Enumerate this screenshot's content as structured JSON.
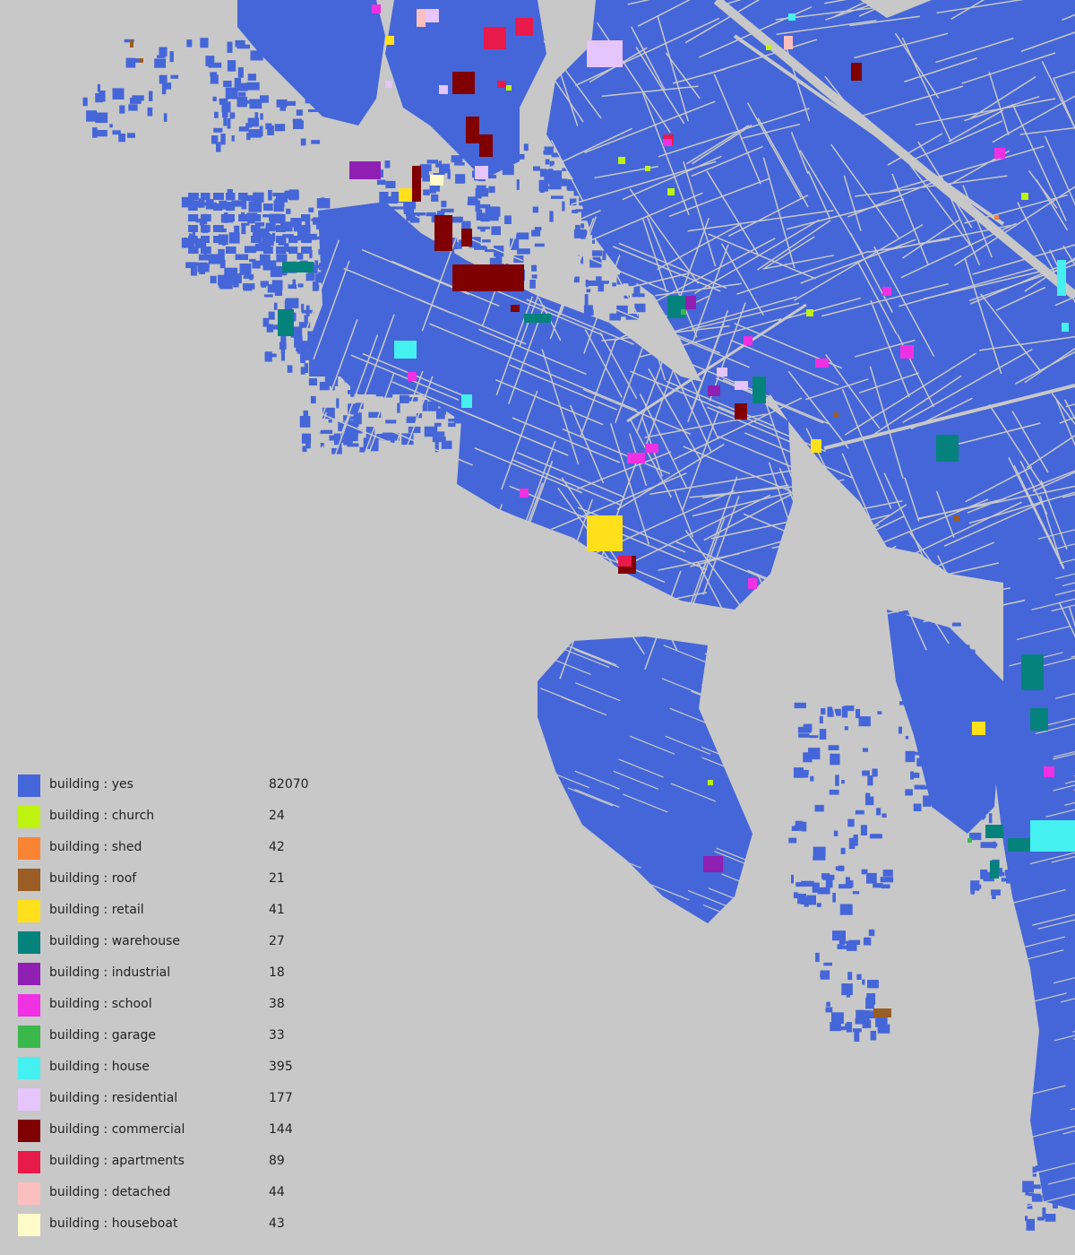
{
  "map": {
    "background_color": "#c8c8c8",
    "default_building_color": "#4566d8"
  },
  "legend": [
    {
      "key": "building",
      "value": "yes",
      "label": "building : yes",
      "count": "82070",
      "color": "#4566d8"
    },
    {
      "key": "building",
      "value": "church",
      "label": "building : church",
      "count": "24",
      "color": "#bef20f"
    },
    {
      "key": "building",
      "value": "shed",
      "label": "building : shed",
      "count": "42",
      "color": "#f98434"
    },
    {
      "key": "building",
      "value": "roof",
      "label": "building : roof",
      "count": "21",
      "color": "#9a5e24"
    },
    {
      "key": "building",
      "value": "retail",
      "label": "building : retail",
      "count": "41",
      "color": "#ffe01b"
    },
    {
      "key": "building",
      "value": "warehouse",
      "label": "building : warehouse",
      "count": "27",
      "color": "#06827c"
    },
    {
      "key": "building",
      "value": "industrial",
      "label": "building : industrial",
      "count": "18",
      "color": "#901fb3"
    },
    {
      "key": "building",
      "value": "school",
      "label": "building : school",
      "count": "38",
      "color": "#f030e3"
    },
    {
      "key": "building",
      "value": "garage",
      "label": "building : garage",
      "count": "33",
      "color": "#3bb84b"
    },
    {
      "key": "building",
      "value": "house",
      "label": "building : house",
      "count": "395",
      "color": "#44f0f0"
    },
    {
      "key": "building",
      "value": "residential",
      "label": "building : residential",
      "count": "177",
      "color": "#e6c4fc"
    },
    {
      "key": "building",
      "value": "commercial",
      "label": "building : commercial",
      "count": "144",
      "color": "#800001"
    },
    {
      "key": "building",
      "value": "apartments",
      "label": "building : apartments",
      "count": "89",
      "color": "#e81a4a"
    },
    {
      "key": "building",
      "value": "detached",
      "label": "building : detached",
      "count": "44",
      "color": "#fcbfbf"
    },
    {
      "key": "building",
      "value": "houseboat",
      "label": "building : houseboat",
      "count": "43",
      "color": "#fffbc8"
    }
  ]
}
